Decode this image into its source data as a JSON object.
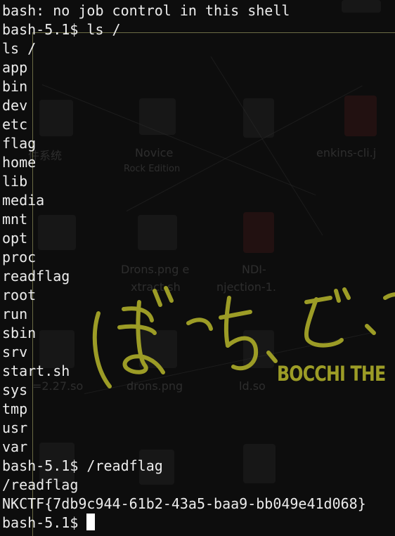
{
  "terminal": {
    "lines": [
      "bash: no job control in this shell",
      "bash-5.1$ ls /",
      "ls /",
      "app",
      "bin",
      "dev",
      "etc",
      "flag",
      "home",
      "lib",
      "media",
      "mnt",
      "opt",
      "proc",
      "readflag",
      "root",
      "run",
      "sbin",
      "srv",
      "start.sh",
      "sys",
      "tmp",
      "usr",
      "var",
      "bash-5.1$ /readflag",
      "/readflag",
      "NKCTF{7db9c944-61b2-43a5-baa9-bb049e41d068}"
    ],
    "prompt": "bash-5.1$ "
  },
  "wallpaper": {
    "artist_text": "ぼっち・ざ・ろ",
    "brand_text": "BOCCHI THE",
    "accent_color": "#9c9c26"
  },
  "desktop_labels": {
    "file_system": "件系统",
    "novice": "Novice",
    "novice_sub": "Rock Edition",
    "jenkins": "enkins-cli.j",
    "drons": "Drons.png e",
    "xtract": "xtract.sh",
    "injection": "NDI-",
    "injection_sub": "njection-1.",
    "so_1": "=2.27.so",
    "drons_png": "drons.png",
    "ld_so": "ld.so"
  }
}
